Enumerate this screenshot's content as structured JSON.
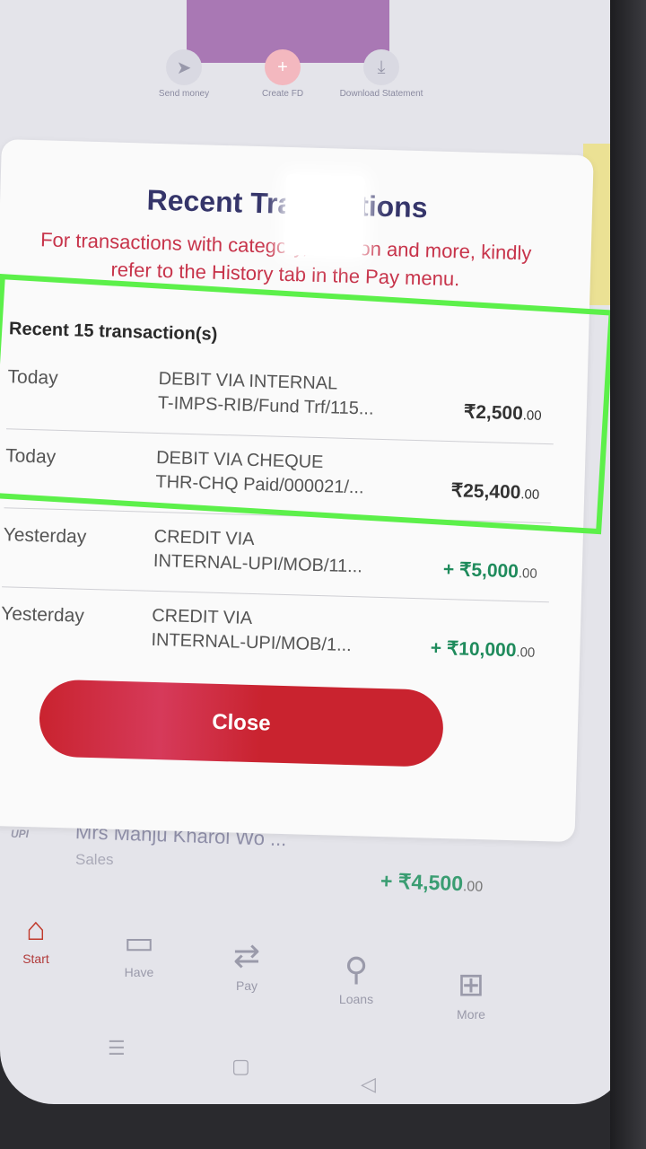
{
  "background": {
    "actions": [
      {
        "label": "Send money",
        "icon": "send-icon"
      },
      {
        "label": "Create FD",
        "icon": "plus-icon"
      },
      {
        "label": "Download Statement",
        "icon": "download-icon"
      }
    ]
  },
  "modal": {
    "title": "Recent Transactions",
    "subtitle_line1": "For transactions with category, location and more, kindly",
    "subtitle_line2": "refer to the History tab in the Pay menu.",
    "count_label": "Recent 15 transaction(s)",
    "transactions": [
      {
        "date": "Today",
        "desc1": "DEBIT VIA INTERNAL",
        "desc2": "T-IMPS-RIB/Fund Trf/115...",
        "amount": "₹2,500",
        "decimals": ".00"
      },
      {
        "date": "Today",
        "desc1": "DEBIT VIA CHEQUE",
        "desc2": "THR-CHQ Paid/000021/...",
        "amount": "₹25,400",
        "decimals": ".00"
      },
      {
        "date": "Yesterday",
        "desc1": "CREDIT VIA",
        "desc2": "INTERNAL-UPI/MOB/11...",
        "amount": "+ ₹5,000",
        "decimals": ".00"
      },
      {
        "date": "Yesterday",
        "desc1": "CREDIT VIA",
        "desc2": "INTERNAL-UPI/MOB/1...",
        "amount": "+ ₹10,000",
        "decimals": ".00"
      }
    ],
    "close_label": "Close"
  },
  "below_list": {
    "badge": "UPI",
    "name": "Mrs Manju Kharol Wo ...",
    "category": "Sales",
    "amount": "+ ₹4,500",
    "decimals": ".00"
  },
  "bottom_nav": [
    {
      "label": "Start",
      "icon": "home-icon"
    },
    {
      "label": "Have",
      "icon": "wallet-icon"
    },
    {
      "label": "Pay",
      "icon": "transfer-icon"
    },
    {
      "label": "Loans",
      "icon": "money-bag-icon"
    },
    {
      "label": "More",
      "icon": "grid-icon"
    }
  ],
  "colors": {
    "accent_red": "#c9232f",
    "title_navy": "#35356a",
    "subtitle_red": "#c7334a",
    "credit_green": "#1f8b5c",
    "highlight_green": "#5cf04a"
  }
}
